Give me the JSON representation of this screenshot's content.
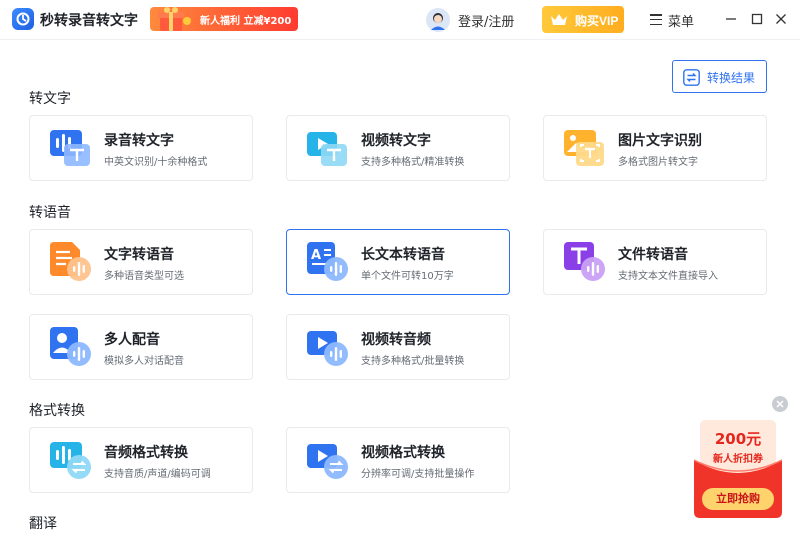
{
  "app": {
    "title": "秒转录音转文字"
  },
  "header": {
    "promo_text": "新人福利 立减¥200",
    "login_label": "登录/注册",
    "vip_label": "购买VIP",
    "menu_label": "菜单"
  },
  "toolbar": {
    "convert_result_label": "转换结果"
  },
  "sections": {
    "to_text": {
      "title": "转文字"
    },
    "to_voice": {
      "title": "转语音"
    },
    "format": {
      "title": "格式转换"
    },
    "translate": {
      "title": "翻译"
    }
  },
  "cards": {
    "audio_to_text": {
      "title": "录音转文字",
      "desc": "中英文识别/十余种格式",
      "icon": "audio-text-icon"
    },
    "video_to_text": {
      "title": "视频转文字",
      "desc": "支持多种格式/精准转换",
      "icon": "video-text-icon"
    },
    "image_ocr": {
      "title": "图片文字识别",
      "desc": "多格式图片转文字",
      "icon": "image-ocr-icon"
    },
    "text_to_voice": {
      "title": "文字转语音",
      "desc": "多种语音类型可选",
      "icon": "text-voice-icon"
    },
    "long_text_to_voice": {
      "title": "长文本转语音",
      "desc": "单个文件可转10万字",
      "icon": "long-text-voice-icon"
    },
    "file_to_voice": {
      "title": "文件转语音",
      "desc": "支持文本文件直接导入",
      "icon": "file-voice-icon"
    },
    "multi_dubbing": {
      "title": "多人配音",
      "desc": "模拟多人对话配音",
      "icon": "multi-dubbing-icon"
    },
    "video_to_audio": {
      "title": "视频转音频",
      "desc": "支持多种格式/批量转换",
      "icon": "video-audio-icon"
    },
    "audio_format": {
      "title": "音频格式转换",
      "desc": "支持音质/声道/编码可调",
      "icon": "audio-format-icon"
    },
    "video_format": {
      "title": "视频格式转换",
      "desc": "分辨率可调/支持批量操作",
      "icon": "video-format-icon"
    }
  },
  "coupon": {
    "amount": "200元",
    "subtitle": "新人折扣券",
    "button_label": "立即抢购"
  },
  "colors": {
    "accent": "#2f73f0",
    "vip": "#ffb62b",
    "coupon_red": "#e5261c"
  }
}
